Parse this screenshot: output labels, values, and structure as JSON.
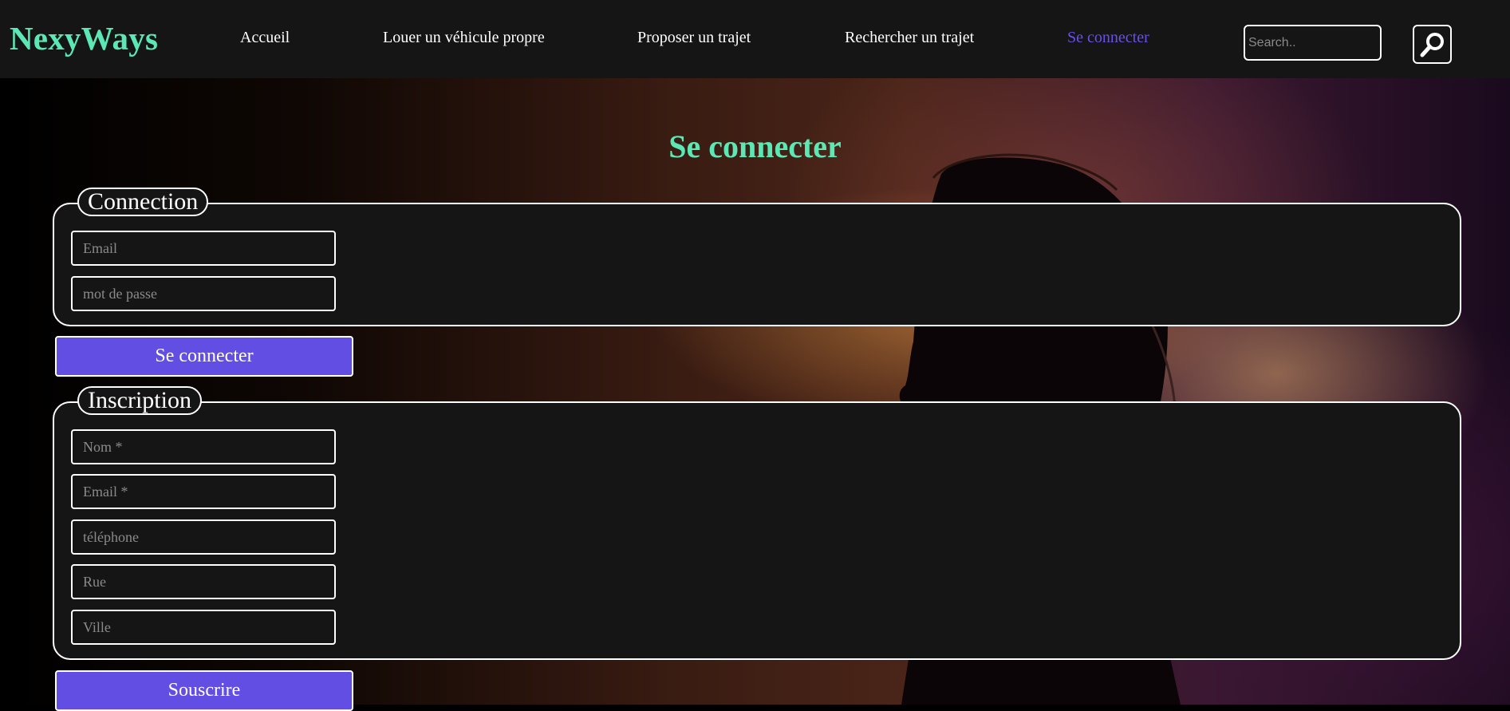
{
  "header": {
    "brand": "NexyWays",
    "nav": [
      {
        "label": "Accueil"
      },
      {
        "label": "Louer un véhicule propre"
      },
      {
        "label": "Proposer un trajet"
      },
      {
        "label": "Rechercher un trajet"
      },
      {
        "label": "Se connecter",
        "active": true
      }
    ],
    "search": {
      "placeholder": "Search..",
      "value": "",
      "icon": "search-icon"
    }
  },
  "page": {
    "title": "Se connecter"
  },
  "login": {
    "legend": "Connection",
    "email_placeholder": "Email",
    "password_placeholder": "mot de passe",
    "submit_label": "Se connecter"
  },
  "signup": {
    "legend": "Inscription",
    "fields": [
      {
        "placeholder": "Nom *"
      },
      {
        "placeholder": "Email *"
      },
      {
        "placeholder": "téléphone"
      },
      {
        "placeholder": "Rue"
      },
      {
        "placeholder": "Ville"
      }
    ],
    "submit_label": "Souscrire"
  },
  "colors": {
    "brand": "#5ce8b5",
    "active_link": "#6a4fe9",
    "button": "#634ee3",
    "panel": "#151515",
    "header": "#151515"
  }
}
